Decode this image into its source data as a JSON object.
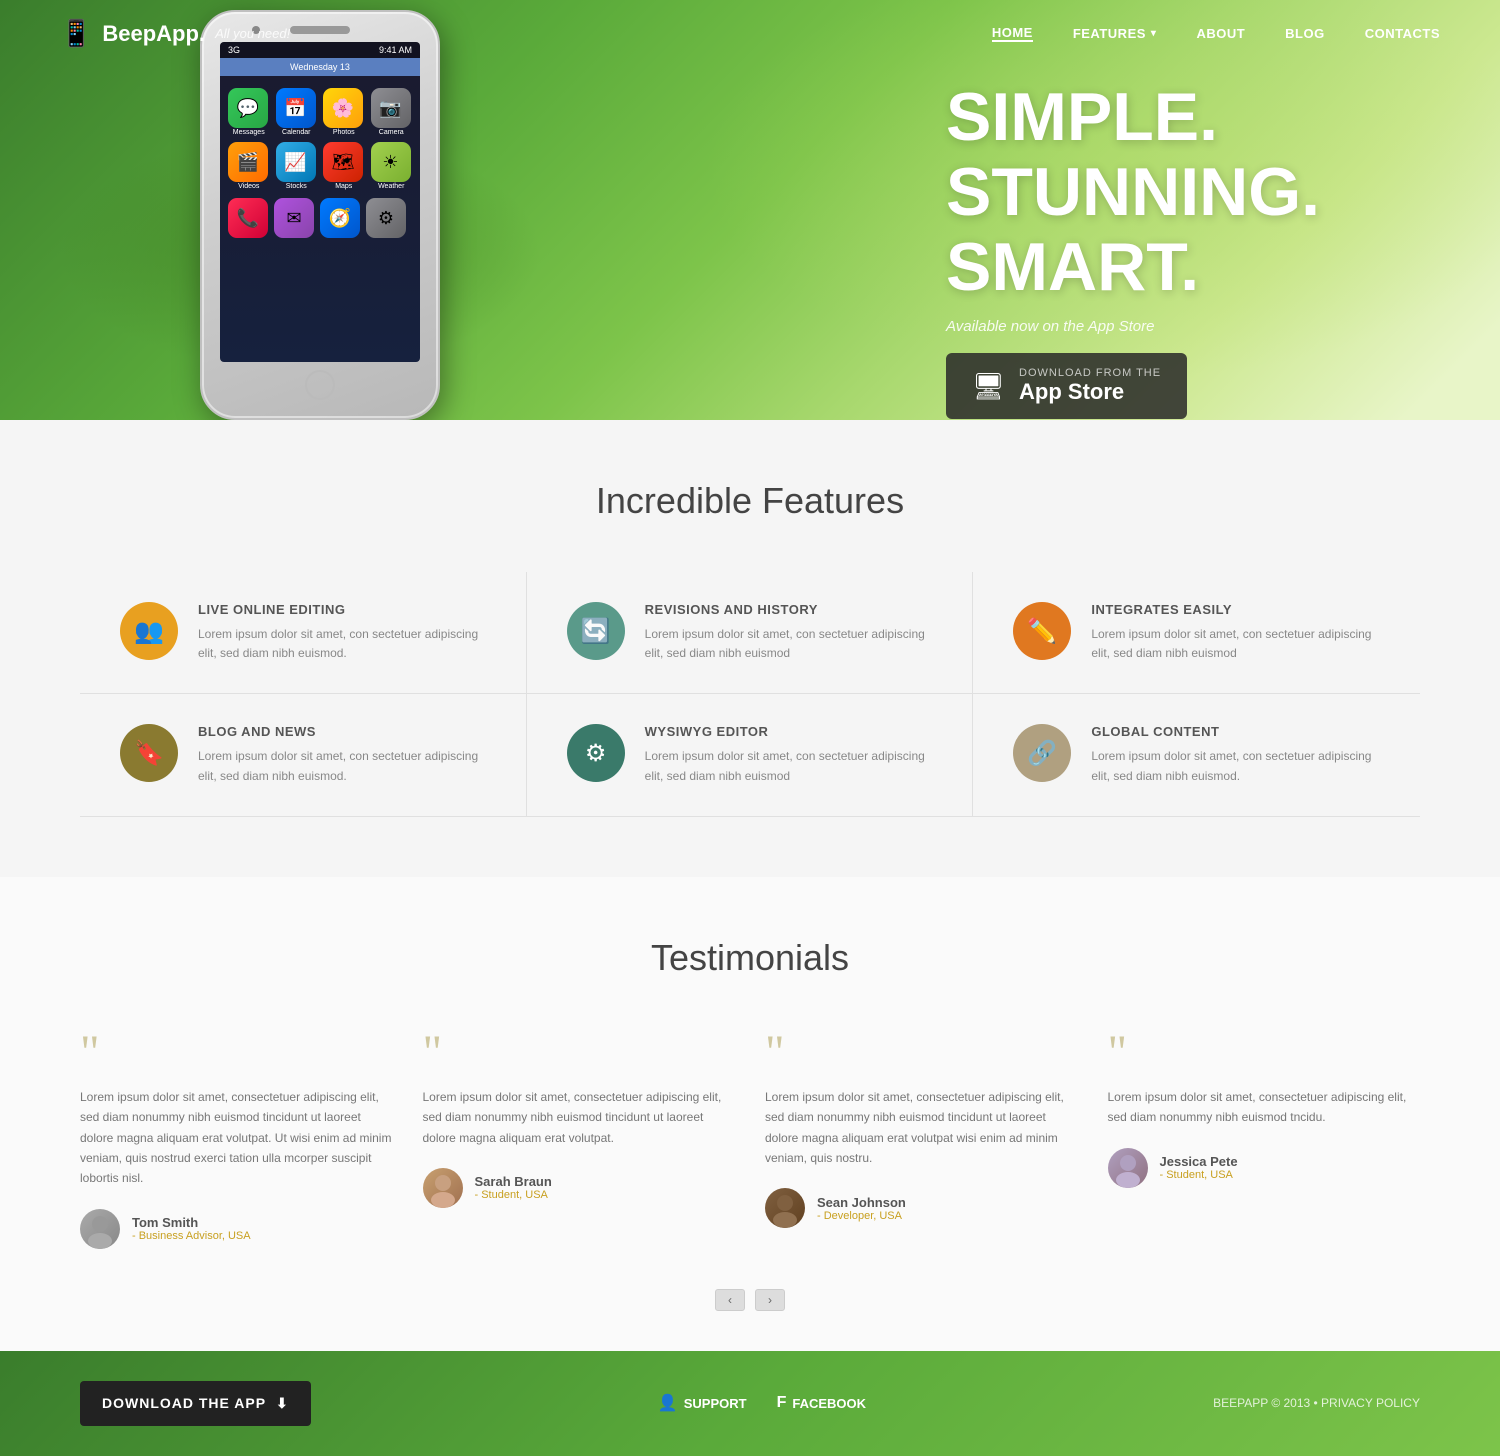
{
  "nav": {
    "logo": "BeepApp.",
    "logo_tagline": "All you need!",
    "items": [
      {
        "label": "HOME",
        "active": true
      },
      {
        "label": "FEATURES",
        "has_dropdown": true
      },
      {
        "label": "ABOUT"
      },
      {
        "label": "BLOG"
      },
      {
        "label": "CONTACTS"
      }
    ]
  },
  "hero": {
    "headline_line1": "SIMPLE.",
    "headline_line2": "STUNNING.",
    "headline_line3": "SMART.",
    "subtitle": "Available now on the App Store",
    "download_label_top": "DOWNLOAD FROM THE",
    "download_label_main": "App Store",
    "phone_time": "9:41 AM",
    "phone_carrier": "3G",
    "phone_date": "Wednesday 13"
  },
  "features": {
    "section_title": "Incredible Features",
    "items": [
      {
        "icon": "👤",
        "icon_class": "icon-orange",
        "title": "LIVE ONLINE EDITING",
        "description": "Lorem ipsum dolor sit amet, con sectetuer adipiscing elit, sed diam nibh euismod."
      },
      {
        "icon": "🔄",
        "icon_class": "icon-teal",
        "title": "REVISIONS AND HISTORY",
        "description": "Lorem ipsum dolor sit amet, con sectetuer adipiscing elit, sed diam nibh euismod"
      },
      {
        "icon": "✏️",
        "icon_class": "icon-orange2",
        "title": "INTEGRATES EASILY",
        "description": "Lorem ipsum dolor sit amet, con sectetuer adipiscing elit, sed diam nibh euismod"
      },
      {
        "icon": "🔖",
        "icon_class": "icon-olive",
        "title": "BLOG AND NEWS",
        "description": "Lorem ipsum dolor sit amet, con sectetuer adipiscing elit, sed diam nibh euismod."
      },
      {
        "icon": "⚙",
        "icon_class": "icon-dark-teal",
        "title": "WYSIWYG EDITOR",
        "description": "Lorem ipsum dolor sit amet, con sectetuer adipiscing elit, sed diam nibh euismod"
      },
      {
        "icon": "🔗",
        "icon_class": "icon-tan",
        "title": "GLOBAL CONTENT",
        "description": "Lorem ipsum dolor sit amet, con sectetuer adipiscing elit, sed diam nibh euismod."
      }
    ]
  },
  "testimonials": {
    "section_title": "Testimonials",
    "items": [
      {
        "text": "Lorem ipsum dolor sit amet, consectetuer adipiscing elit, sed diam nonummy nibh euismod tincidunt ut laoreet dolore magna aliquam erat volutpat. Ut wisi enim ad minim veniam, quis nostrud exerci tation ulla mcorper suscipit lobortis nisl.",
        "name": "Tom Smith",
        "role": "- Business Advisor, USA",
        "avatar_class": "avatar-tom",
        "avatar_emoji": "👤"
      },
      {
        "text": "Lorem ipsum dolor sit amet, consectetuer adipiscing elit, sed diam nonummy nibh euismod tincidunt ut laoreet dolore magna aliquam erat volutpat.",
        "name": "Sarah Braun",
        "role": "- Student, USA",
        "avatar_class": "avatar-sarah",
        "avatar_emoji": "👩"
      },
      {
        "text": "Lorem ipsum dolor sit amet, consectetuer adipiscing elit, sed diam nonummy nibh euismod tincidunt ut laoreet dolore magna aliquam erat volutpat wisi enim ad minim veniam, quis nostru.",
        "name": "Sean Johnson",
        "role": "- Developer, USA",
        "avatar_class": "avatar-sean",
        "avatar_emoji": "👨"
      },
      {
        "text": "Lorem ipsum dolor sit amet, consectetuer adipiscing elit, sed diam nonummy nibh euismod tncidu.",
        "name": "Jessica Pete",
        "role": "- Student, USA",
        "avatar_class": "avatar-jessica",
        "avatar_emoji": "👩"
      }
    ],
    "nav_prev": "‹",
    "nav_next": "›"
  },
  "footer": {
    "download_label": "DOWNLOAD THE APP",
    "download_icon": "⬇",
    "support_label": "SUPPORT",
    "support_icon": "👤",
    "facebook_label": "FACEBOOK",
    "facebook_icon": "f",
    "copyright": "BEEPAPP © 2013 • PRIVACY POLICY"
  }
}
